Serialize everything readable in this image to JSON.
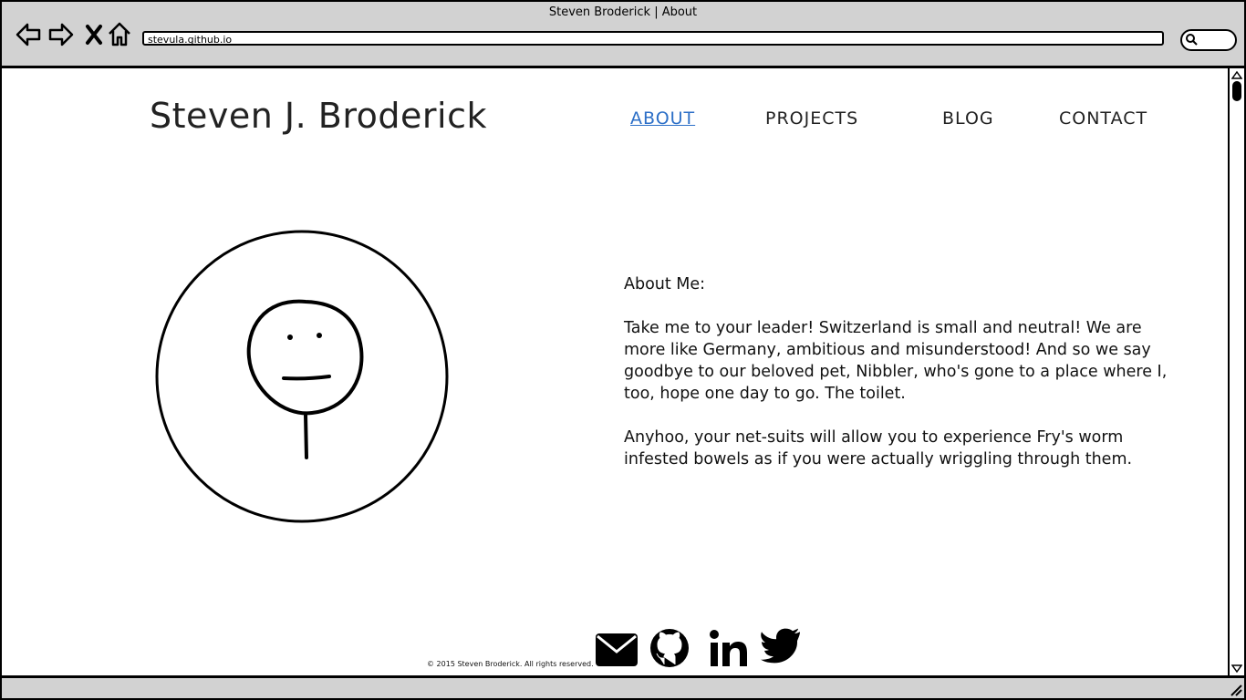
{
  "window": {
    "title": "Steven Broderick | About",
    "url": "stevula.github.io"
  },
  "browser_icons": [
    "back-arrow-icon",
    "forward-arrow-icon",
    "close-icon",
    "home-icon",
    "search-icon"
  ],
  "site": {
    "title": "Steven J. Broderick",
    "nav": [
      {
        "label": "ABOUT",
        "active": true
      },
      {
        "label": "PROJECTS",
        "active": false
      },
      {
        "label": "BLOG",
        "active": false
      },
      {
        "label": "CONTACT",
        "active": false
      }
    ]
  },
  "about": {
    "heading": "About Me:",
    "paragraph1": "Take me to your leader! Switzerland is small and neutral! We are more like Germany, ambitious and misunderstood! And so we say goodbye to our beloved pet, Nibbler, who's gone to a place where I, too, hope one day to go. The toilet.",
    "paragraph2": "Anyhoo, your net-suits will allow you to experience Fry's worm infested bowels as if you were actually wriggling through them."
  },
  "footer": {
    "copyright": "© 2015 Steven Broderick. All rights reserved.",
    "social_icons": [
      "envelope-icon",
      "github-icon",
      "linkedin-icon",
      "twitter-icon"
    ]
  },
  "colors": {
    "chrome": "#d2d2d2",
    "active_link": "#2c6fc7",
    "text": "#222222"
  }
}
